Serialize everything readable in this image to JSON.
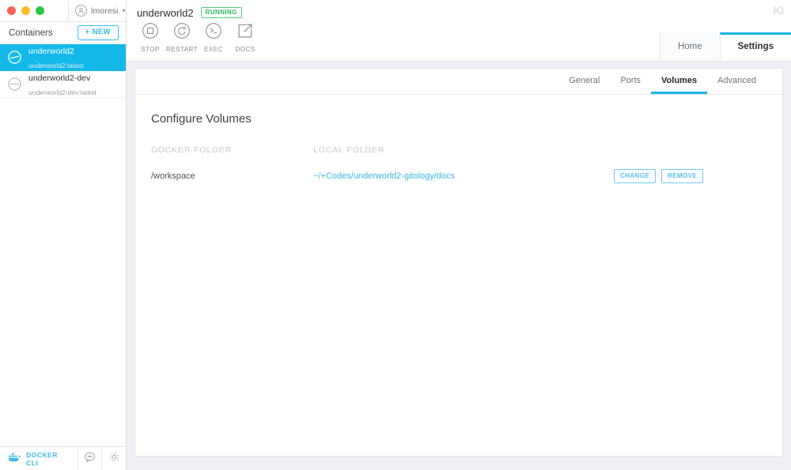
{
  "window": {
    "traffic_lights": [
      "close",
      "minimize",
      "zoom"
    ],
    "account": {
      "name": "lmoresi",
      "avatar_icon": "user-avatar-icon",
      "caret_icon": "chevron-down-icon"
    },
    "brand_logo": "KI"
  },
  "sidebar": {
    "header": {
      "title": "Containers",
      "new_button": "+ NEW"
    },
    "containers": [
      {
        "name": "underworld2",
        "image": "underworld2:latest",
        "state_icon": "container-running-icon",
        "selected": true
      },
      {
        "name": "underworld2-dev",
        "image": "underworld2-dev:latest",
        "state_icon": "container-stopped-icon",
        "selected": false
      }
    ],
    "statusbar": {
      "cli_label": "DOCKER CLI",
      "cli_icon": "docker-whale-icon",
      "feedback_icon": "speech-bubble-icon",
      "preferences_icon": "gear-icon"
    }
  },
  "header": {
    "container_name": "underworld2",
    "status_badge": "RUNNING",
    "toolbar": [
      {
        "label": "STOP",
        "icon": "stop-square-icon"
      },
      {
        "label": "RESTART",
        "icon": "restart-arrow-icon"
      },
      {
        "label": "EXEC",
        "icon": "terminal-prompt-icon"
      },
      {
        "label": "DOCS",
        "icon": "external-link-icon"
      }
    ],
    "tabs": [
      {
        "label": "Home",
        "active": false
      },
      {
        "label": "Settings",
        "active": true
      }
    ]
  },
  "settings": {
    "subtabs": [
      {
        "label": "General",
        "active": false
      },
      {
        "label": "Ports",
        "active": false
      },
      {
        "label": "Volumes",
        "active": true
      },
      {
        "label": "Advanced",
        "active": false
      }
    ],
    "panel_title": "Configure Volumes",
    "columns": {
      "docker": "DOCKER FOLDER",
      "local": "LOCAL FOLDER"
    },
    "volumes": [
      {
        "docker_folder": "/workspace",
        "local_folder": "~/+Codes/underworld2-gitology/docs",
        "change_button": "CHANGE",
        "remove_button": "REMOVE"
      }
    ]
  },
  "colors": {
    "accent": "#18b6e9",
    "selected_row": "#14b9ea",
    "running_green": "#2fb95f",
    "link_blue": "#39b8ea",
    "app_bg": "#eef0f4"
  }
}
